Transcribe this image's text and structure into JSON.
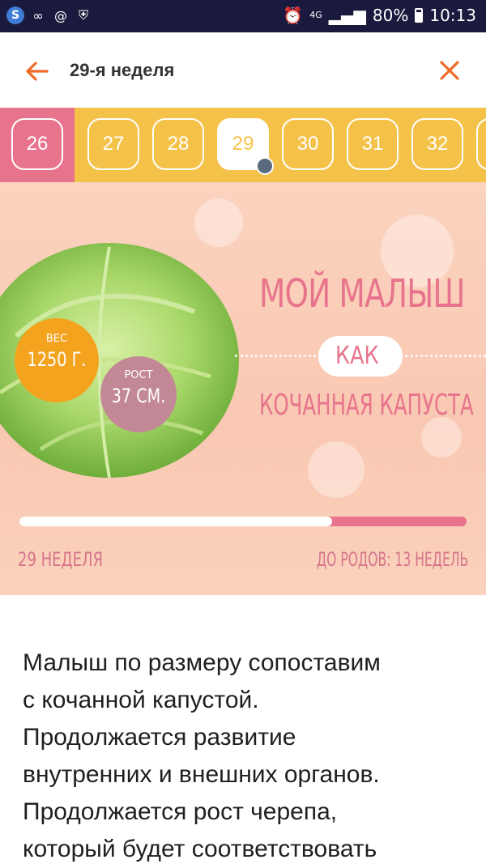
{
  "status_bar": {
    "left_icons": [
      "s-icon",
      "link-icon",
      "at-icon",
      "shield-icon"
    ],
    "network": "4G",
    "battery": "80%",
    "time": "10:13"
  },
  "header": {
    "title": "29-я неделя"
  },
  "weeks": {
    "items": [
      "26",
      "27",
      "28",
      "29",
      "30",
      "31",
      "32"
    ],
    "selected": "29"
  },
  "hero": {
    "line1": "МОЙ МАЛЫШ",
    "line2": "КАК",
    "line3": "КОЧАННАЯ КАПУСТА",
    "weight_label": "ВЕС",
    "weight_value": "1250 Г.",
    "height_label": "РОСТ",
    "height_value": "37 СМ.",
    "progress_fraction": 0.7,
    "week_label": "29 НЕДЕЛЯ",
    "remaining_label": "ДО РОДОВ: 13 НЕДЕЛЬ"
  },
  "body": {
    "lines": [
      "Малыш по размеру сопоставим",
      "с кочанной капустой.",
      "Продолжается развитие",
      "внутренних и внешних органов.",
      "Продолжается рост черепа,",
      "который будет соответствовать"
    ]
  },
  "colors": {
    "accent": "#f4c249",
    "pink": "#e8738c",
    "back_arrow": "#f26a2a"
  }
}
